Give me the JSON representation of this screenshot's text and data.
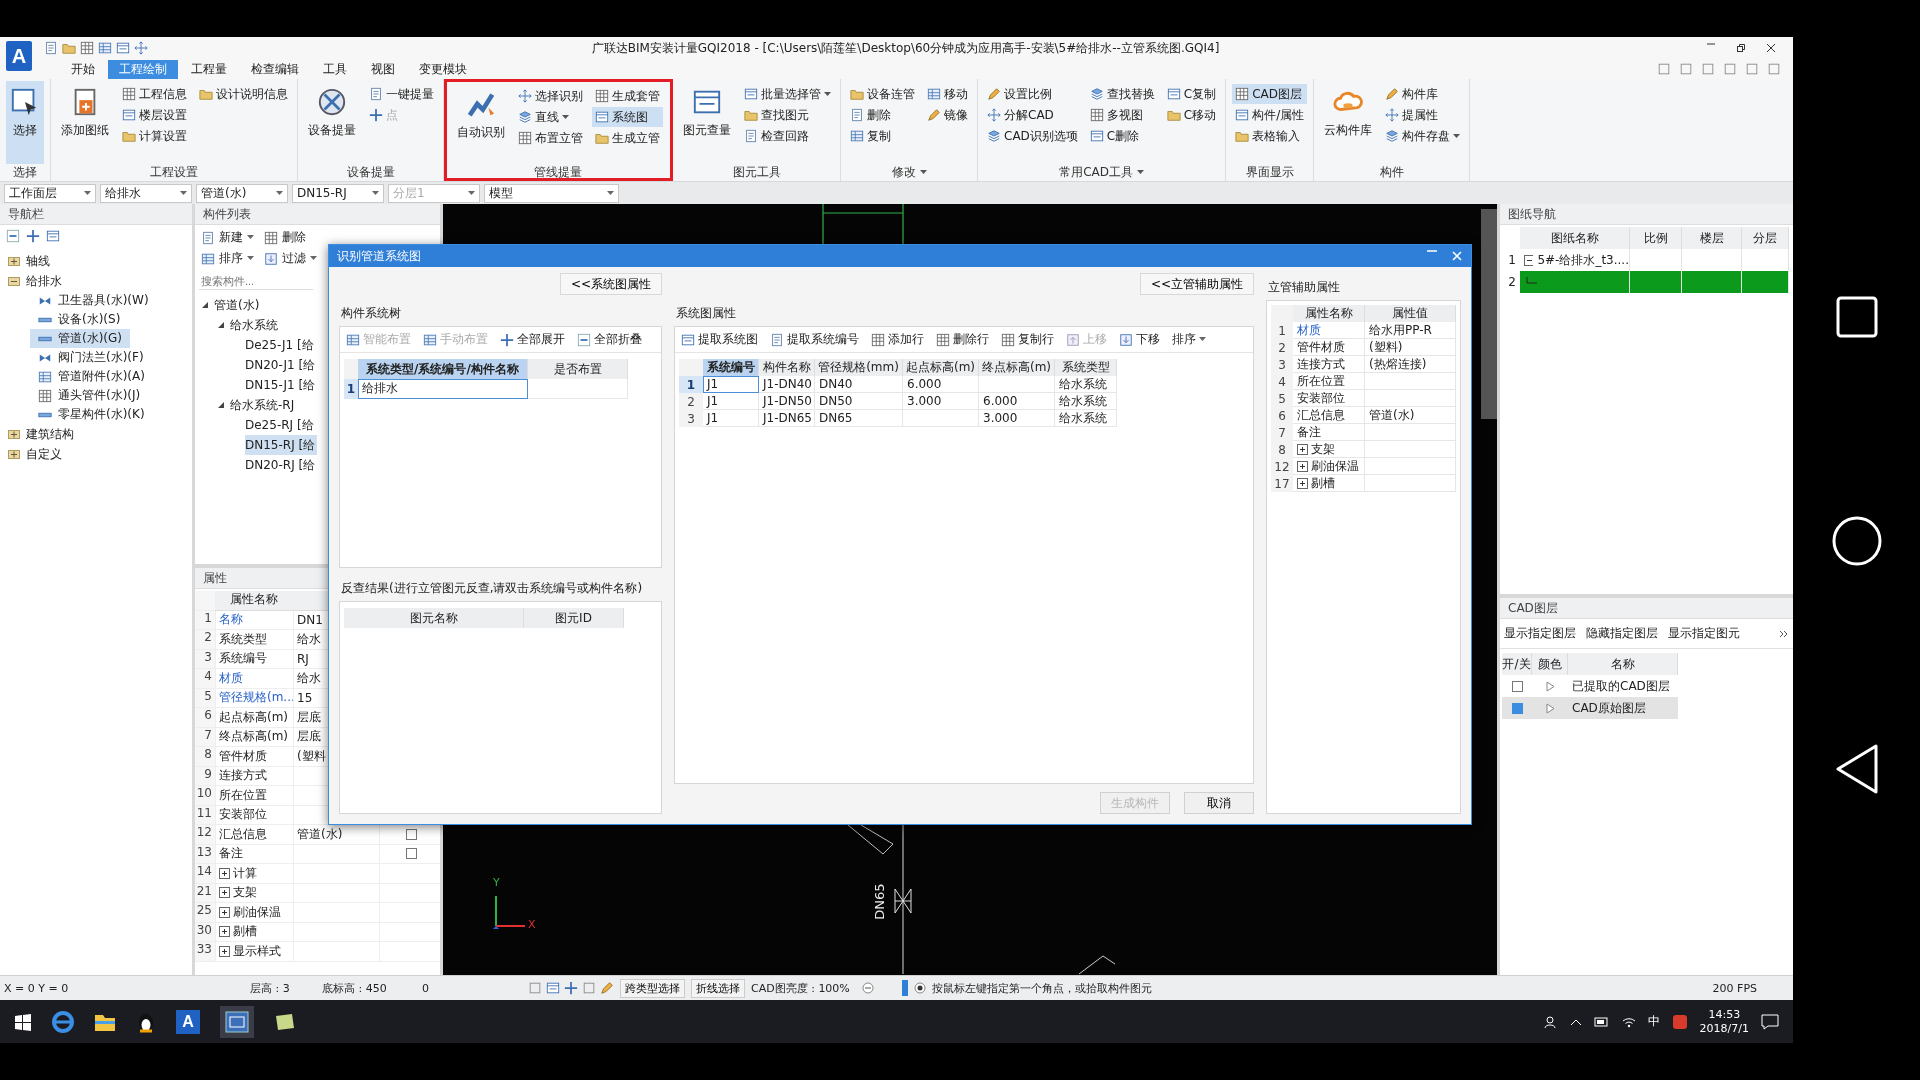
{
  "title_bar": {
    "logo": "A",
    "title": "广联达BIM安装计量GQI2018 - [C:\\Users\\陌莲笙\\Desktop\\60分钟成为应用高手-安装\\5#给排水--立管系统图.GQI4]"
  },
  "tabs": [
    {
      "label": "开始",
      "selected": false
    },
    {
      "label": "工程绘制",
      "selected": true
    },
    {
      "label": "工程量",
      "selected": false
    },
    {
      "label": "检查编辑",
      "selected": false
    },
    {
      "label": "工具",
      "selected": false
    },
    {
      "label": "视图",
      "selected": false
    },
    {
      "label": "变更模块",
      "selected": false
    }
  ],
  "ribbon_groups": [
    {
      "label": "选择",
      "highlighted": false,
      "columns": [
        {
          "kind": "large",
          "label": "选择",
          "selected": true
        }
      ]
    },
    {
      "label": "工程设置",
      "highlighted": false,
      "columns": [
        {
          "kind": "large",
          "label": "添加图纸",
          "selected": false
        },
        {
          "kind": "stack",
          "items": [
            {
              "label": "工程信息",
              "selected": false,
              "disabled": false
            },
            {
              "label": "楼层设置",
              "selected": false,
              "disabled": false
            },
            {
              "label": "计算设置",
              "selected": false,
              "disabled": false
            }
          ]
        },
        {
          "kind": "stack",
          "items": [
            {
              "label": "设计说明信息",
              "selected": false,
              "disabled": false
            }
          ]
        }
      ]
    },
    {
      "label": "设备提量",
      "highlighted": false,
      "columns": [
        {
          "kind": "large",
          "label": "设备提量",
          "selected": false
        },
        {
          "kind": "stack",
          "items": [
            {
              "label": "一键提量",
              "selected": false,
              "disabled": false
            },
            {
              "label": "点",
              "selected": false,
              "disabled": true
            }
          ]
        }
      ]
    },
    {
      "label": "管线提量",
      "highlighted": true,
      "columns": [
        {
          "kind": "large",
          "label": "自动识别",
          "selected": false
        },
        {
          "kind": "stack",
          "items": [
            {
              "label": "选择识别",
              "selected": false,
              "disabled": false
            },
            {
              "label": "直线",
              "selected": false,
              "disabled": false,
              "menu": true
            },
            {
              "label": "布置立管",
              "selected": false,
              "disabled": false
            }
          ]
        },
        {
          "kind": "stack",
          "items": [
            {
              "label": "生成套管",
              "selected": false,
              "disabled": false
            },
            {
              "label": "系统图",
              "selected": true,
              "disabled": false
            },
            {
              "label": "生成立管",
              "selected": false,
              "disabled": false
            }
          ]
        }
      ]
    },
    {
      "label": "图元工具",
      "highlighted": false,
      "columns": [
        {
          "kind": "large",
          "label": "图元查量",
          "selected": false
        },
        {
          "kind": "stack",
          "items": [
            {
              "label": "批量选择管",
              "selected": false,
              "disabled": false,
              "menu": true
            },
            {
              "label": "查找图元",
              "selected": false,
              "disabled": false
            },
            {
              "label": "检查回路",
              "selected": false,
              "disabled": false
            }
          ]
        }
      ]
    },
    {
      "label": "修改",
      "highlighted": false,
      "menu": true,
      "columns": [
        {
          "kind": "stack",
          "items": [
            {
              "label": "设备连管",
              "selected": false,
              "disabled": false
            },
            {
              "label": "删除",
              "selected": false,
              "disabled": false
            },
            {
              "label": "复制",
              "selected": false,
              "disabled": false
            }
          ]
        },
        {
          "kind": "stack",
          "items": [
            {
              "label": "移动",
              "selected": false,
              "disabled": false
            },
            {
              "label": "镜像",
              "selected": false,
              "disabled": false
            }
          ]
        }
      ]
    },
    {
      "label": "常用CAD工具",
      "highlighted": false,
      "menu": true,
      "columns": [
        {
          "kind": "stack",
          "items": [
            {
              "label": "设置比例",
              "selected": false,
              "disabled": false
            },
            {
              "label": "分解CAD",
              "selected": false,
              "disabled": false
            },
            {
              "label": "CAD识别选项",
              "selected": false,
              "disabled": false
            }
          ]
        },
        {
          "kind": "stack",
          "items": [
            {
              "label": "查找替换",
              "selected": false,
              "disabled": false
            },
            {
              "label": "多视图",
              "selected": false,
              "disabled": false
            },
            {
              "label": "C删除",
              "selected": false,
              "disabled": false
            }
          ]
        },
        {
          "kind": "stack",
          "items": [
            {
              "label": "C复制",
              "selected": false,
              "disabled": false
            },
            {
              "label": "C移动",
              "selected": false,
              "disabled": false
            }
          ]
        }
      ]
    },
    {
      "label": "界面显示",
      "highlighted": false,
      "columns": [
        {
          "kind": "stack",
          "items": [
            {
              "label": "CAD图层",
              "selected": true,
              "disabled": false
            },
            {
              "label": "构件/属性",
              "selected": false,
              "disabled": false
            },
            {
              "label": "表格输入",
              "selected": false,
              "disabled": false
            }
          ]
        }
      ]
    },
    {
      "label": "构件",
      "highlighted": false,
      "columns": [
        {
          "kind": "large",
          "label": "云构件库",
          "selected": false
        },
        {
          "kind": "stack",
          "items": [
            {
              "label": "构件库",
              "selected": false,
              "disabled": false
            },
            {
              "label": "提属性",
              "selected": false,
              "disabled": false
            },
            {
              "label": "构件存盘",
              "selected": false,
              "disabled": false,
              "menu": true
            }
          ]
        }
      ]
    }
  ],
  "selectors": [
    {
      "value": "工作面层",
      "disabled": false
    },
    {
      "value": "给排水",
      "disabled": false
    },
    {
      "value": "管道(水)",
      "disabled": false
    },
    {
      "value": "DN15-RJ",
      "disabled": false
    },
    {
      "value": "分层1",
      "disabled": true
    },
    {
      "value": "模型",
      "disabled": false
    }
  ],
  "nav": {
    "title": "导航栏",
    "items": [
      {
        "label": "轴线",
        "expanded": false,
        "selected": false
      },
      {
        "label": "给排水",
        "expanded": true,
        "selected": false,
        "children": [
          {
            "label": "卫生器具(水)(W)",
            "selected": false
          },
          {
            "label": "设备(水)(S)",
            "selected": false
          },
          {
            "label": "管道(水)(G)",
            "selected": true
          },
          {
            "label": "阀门法兰(水)(F)",
            "selected": false
          },
          {
            "label": "管道附件(水)(A)",
            "selected": false
          },
          {
            "label": "通头管件(水)(J)",
            "selected": false
          },
          {
            "label": "零星构件(水)(K)",
            "selected": false
          }
        ]
      },
      {
        "label": "建筑结构",
        "expanded": false,
        "selected": false
      },
      {
        "label": "自定义",
        "expanded": false,
        "selected": false
      }
    ]
  },
  "components": {
    "title": "构件列表",
    "toolbar": [
      {
        "label": "新建",
        "menu": true
      },
      {
        "label": "删除"
      },
      {
        "label": "排序",
        "menu": true
      },
      {
        "label": "过滤",
        "menu": true
      }
    ],
    "search_placeholder": "搜索构件...",
    "tree": [
      {
        "label": "管道(水)",
        "expanded": true,
        "children": [
          {
            "label": "给水系统",
            "expanded": true,
            "children": [
              {
                "label": "De25-J1 [给",
                "selected": false
              },
              {
                "label": "DN20-J1 [给",
                "selected": false
              },
              {
                "label": "DN15-J1 [给",
                "selected": false
              }
            ]
          },
          {
            "label": "给水系统-RJ",
            "expanded": true,
            "children": [
              {
                "label": "De25-RJ [给",
                "selected": false
              },
              {
                "label": "DN15-RJ [给",
                "selected": true
              },
              {
                "label": "DN20-RJ [给",
                "selected": false
              }
            ]
          }
        ]
      }
    ]
  },
  "properties": {
    "title": "属性",
    "header": "属性名称",
    "rows": [
      {
        "num": "1",
        "name": "名称",
        "value": "DN1",
        "highlight": true,
        "kind": "field"
      },
      {
        "num": "2",
        "name": "系统类型",
        "value": "给水",
        "highlight": false,
        "kind": "field"
      },
      {
        "num": "3",
        "name": "系统编号",
        "value": "RJ",
        "highlight": false,
        "kind": "field"
      },
      {
        "num": "4",
        "name": "材质",
        "value": "给水",
        "highlight": true,
        "kind": "field"
      },
      {
        "num": "5",
        "name": "管径规格(m...",
        "value": "15",
        "highlight": true,
        "kind": "field"
      },
      {
        "num": "6",
        "name": "起点标高(m)",
        "value": "层底",
        "highlight": false,
        "kind": "field"
      },
      {
        "num": "7",
        "name": "终点标高(m)",
        "value": "层底",
        "highlight": false,
        "kind": "field"
      },
      {
        "num": "8",
        "name": "管件材质",
        "value": "(塑料",
        "highlight": false,
        "kind": "field"
      },
      {
        "num": "9",
        "name": "连接方式",
        "highlight": false,
        "kind": "field"
      },
      {
        "num": "10",
        "name": "所在位置",
        "highlight": false,
        "kind": "field"
      },
      {
        "num": "11",
        "name": "安装部位",
        "highlight": false,
        "kind": "field"
      },
      {
        "num": "12",
        "name": "汇总信息",
        "value": "管道(水)",
        "highlight": false,
        "kind": "field",
        "checked": false
      },
      {
        "num": "13",
        "name": "备注",
        "highlight": false,
        "kind": "field",
        "checked": false
      },
      {
        "num": "14",
        "name": "计算",
        "highlight": false,
        "kind": "group"
      },
      {
        "num": "21",
        "name": "支架",
        "highlight": false,
        "kind": "group"
      },
      {
        "num": "25",
        "name": "刷油保温",
        "highlight": false,
        "kind": "group"
      },
      {
        "num": "30",
        "name": "剔槽",
        "highlight": false,
        "kind": "group"
      },
      {
        "num": "33",
        "name": "显示样式",
        "highlight": false,
        "kind": "group"
      }
    ]
  },
  "canvas": {
    "pipe_label": "DN65",
    "axis_y": "Y",
    "axis_x": "X"
  },
  "dialog": {
    "title": "识别管道系统图",
    "left_button": "<<系统图属性",
    "right_button": "<<立管辅助属性",
    "tree_group": {
      "title": "构件系统树",
      "toolbar": [
        {
          "label": "智能布置",
          "disabled": true
        },
        {
          "label": "手动布置",
          "disabled": true
        },
        {
          "label": "全部展开",
          "disabled": false
        },
        {
          "label": "全部折叠",
          "disabled": false
        }
      ],
      "columns": [
        {
          "label": "系统类型/系统编号/构件名称",
          "selected": true
        },
        {
          "label": "是否布置",
          "selected": false
        }
      ],
      "rows": [
        {
          "num": "1",
          "name": "给排水"
        }
      ]
    },
    "reverse_group": {
      "title": "反查结果(进行立管图元反查,请双击系统编号或构件名称)",
      "columns": [
        "图元名称",
        "图元ID"
      ]
    },
    "props_group": {
      "title": "系统图属性",
      "toolbar": [
        {
          "label": "提取系统图",
          "disabled": false
        },
        {
          "label": "提取系统编号",
          "disabled": false
        },
        {
          "label": "添加行",
          "disabled": false
        },
        {
          "label": "删除行",
          "disabled": false
        },
        {
          "label": "复制行",
          "disabled": false
        },
        {
          "label": "上移",
          "disabled": true
        },
        {
          "label": "下移",
          "disabled": false
        },
        {
          "label": "排序",
          "disabled": false,
          "menu": true
        }
      ],
      "columns": [
        {
          "label": "系统编号",
          "selected": true
        },
        {
          "label": "构件名称",
          "selected": false
        },
        {
          "label": "管径规格(mm)",
          "selected": false
        },
        {
          "label": "起点标高(m)",
          "selected": false
        },
        {
          "label": "终点标高(m)",
          "selected": false
        },
        {
          "label": "系统类型",
          "selected": false
        }
      ],
      "rows": [
        {
          "num": "1",
          "selected": true,
          "cells": [
            "J1",
            "J1-DN40",
            "DN40",
            "6.000",
            null,
            "给水系统"
          ]
        },
        {
          "num": "2",
          "selected": false,
          "cells": [
            "J1",
            "J1-DN50",
            "DN50",
            "3.000",
            "6.000",
            "给水系统"
          ]
        },
        {
          "num": "3",
          "selected": false,
          "cells": [
            "J1",
            "J1-DN65",
            "DN65",
            null,
            "3.000",
            "给水系统"
          ]
        }
      ]
    },
    "buttons": [
      {
        "label": "生成构件",
        "disabled": true
      },
      {
        "label": "取消",
        "disabled": false
      }
    ],
    "riser_group": {
      "title": "立管辅助属性",
      "columns": [
        "属性名称",
        "属性值"
      ],
      "rows": [
        {
          "num": "1",
          "name": "材质",
          "value": "给水用PP-R",
          "highlight": true,
          "kind": "field"
        },
        {
          "num": "2",
          "name": "管件材质",
          "value": "(塑料)",
          "highlight": false,
          "kind": "field"
        },
        {
          "num": "3",
          "name": "连接方式",
          "value": "(热熔连接)",
          "highlight": false,
          "kind": "field"
        },
        {
          "num": "4",
          "name": "所在位置",
          "highlight": false,
          "kind": "field"
        },
        {
          "num": "5",
          "name": "安装部位",
          "highlight": false,
          "kind": "field"
        },
        {
          "num": "6",
          "name": "汇总信息",
          "value": "管道(水)",
          "highlight": false,
          "kind": "field"
        },
        {
          "num": "7",
          "name": "备注",
          "highlight": false,
          "kind": "field"
        },
        {
          "num": "8",
          "name": "支架",
          "highlight": false,
          "kind": "group"
        },
        {
          "num": "12",
          "name": "刷油保温",
          "highlight": false,
          "kind": "group"
        },
        {
          "num": "17",
          "name": "剔槽",
          "highlight": false,
          "kind": "group"
        }
      ]
    }
  },
  "drawing_nav": {
    "title": "图纸导航",
    "columns": [
      "图纸名称",
      "比例",
      "楼层",
      "分层"
    ],
    "rows": [
      {
        "num": "1",
        "name": "5#-给排水_t3....",
        "expanded": true,
        "selected": false
      },
      {
        "num": "2",
        "selected": true
      }
    ]
  },
  "cad_layers": {
    "title": "CAD图层",
    "toolbar": [
      "显示指定图层",
      "隐藏指定图层",
      "显示指定图元"
    ],
    "columns": [
      "开/关",
      "颜色",
      "名称"
    ],
    "rows": [
      {
        "name": "已提取的CAD图层",
        "on": false,
        "selected": false
      },
      {
        "name": "CAD原始图层",
        "on": true,
        "selected": true
      }
    ]
  },
  "status_bar": {
    "coords": "X = 0 Y = 0",
    "floor_height": "层高 : 3",
    "base_elevation": "底标高 : 450",
    "value": "0",
    "buttons": [
      "跨类型选择",
      "折线选择"
    ],
    "brightness": "CAD图亮度 : 100%",
    "hint": "按鼠标左键指定第一个角点，或拾取构件图元",
    "fps": "200 FPS"
  },
  "taskbar": {
    "app_letter": "A",
    "ime": "中",
    "time": "14:53",
    "date": "2018/7/1"
  }
}
